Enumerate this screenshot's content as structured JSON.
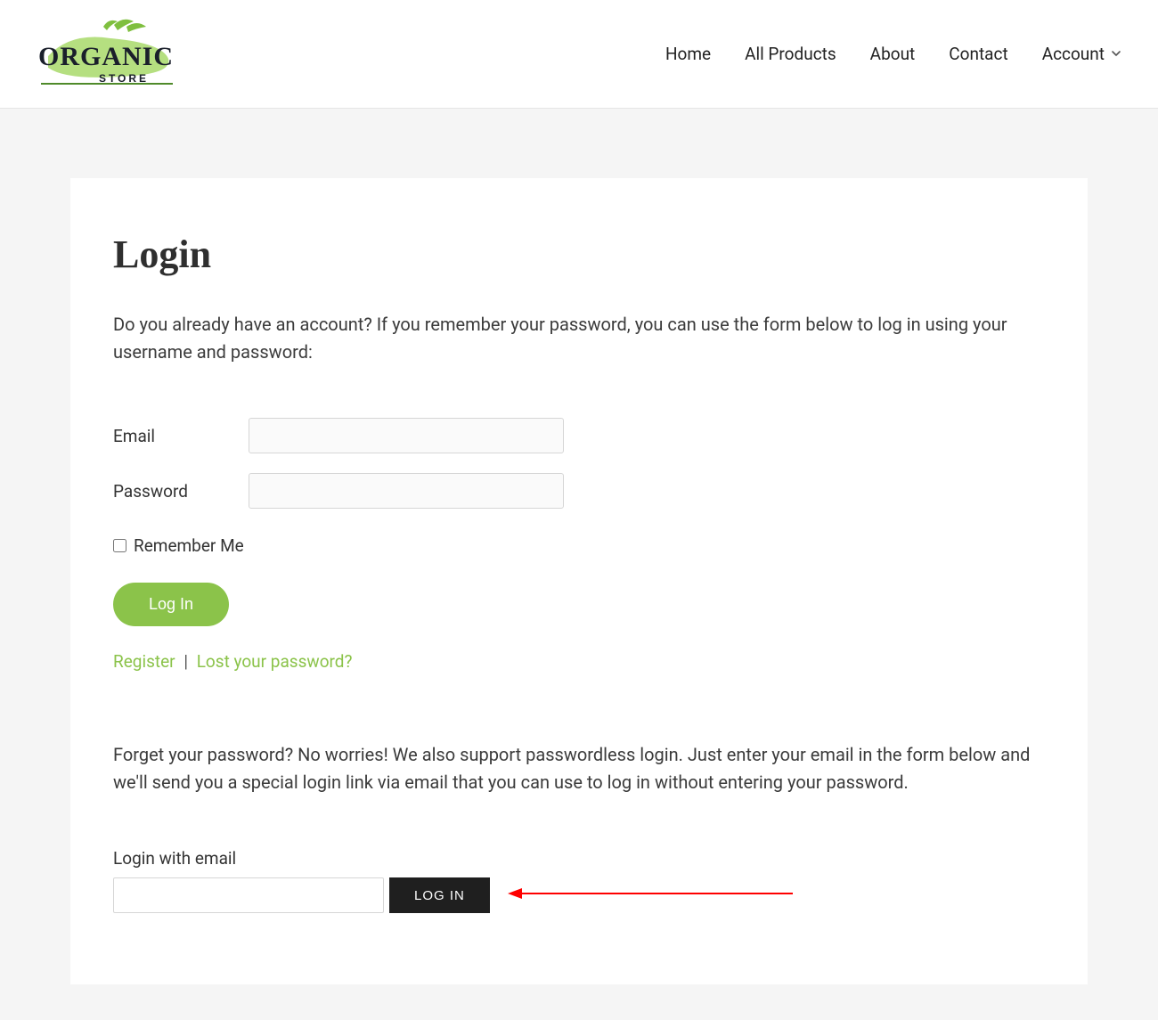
{
  "brand": {
    "name": "ORGANIC",
    "subtitle": "STORE"
  },
  "nav": {
    "home": "Home",
    "all_products": "All Products",
    "about": "About",
    "contact": "Contact",
    "account": "Account"
  },
  "page": {
    "title": "Login",
    "intro": "Do you already have an account? If you remember your password, you can use the form below to log in using your username and password:",
    "email_label": "Email",
    "password_label": "Password",
    "remember_label": "Remember Me",
    "login_btn": "Log In",
    "register_link": "Register",
    "separator": "|",
    "lost_pw_link": "Lost your password?",
    "passwordless_intro": "Forget your password? No worries! We also support passwordless login. Just enter your email in the form below and we'll send you a special login link via email that you can use to log in without entering your password.",
    "passwordless_label": "Login with email",
    "passwordless_btn": "LOG IN"
  },
  "form_values": {
    "email": "",
    "password": "",
    "remember": false,
    "passwordless_email": ""
  }
}
